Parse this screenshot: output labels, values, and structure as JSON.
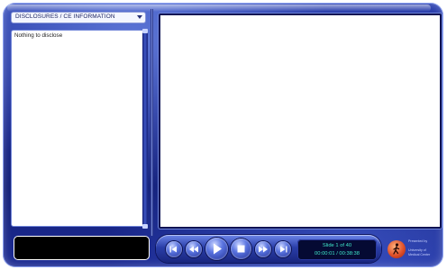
{
  "topic_select": {
    "value": "DISCLOSURES / CE INFORMATION"
  },
  "notes": {
    "text": "Nothing to disclose"
  },
  "player": {
    "slide_counter": "Slide 1 of 40",
    "time": "00:00:01 / 00:38:38",
    "controls": [
      {
        "name": "first-slide-button",
        "icon": "skip-to-start"
      },
      {
        "name": "rewind-button",
        "icon": "rewind"
      },
      {
        "name": "play-button",
        "icon": "play"
      },
      {
        "name": "stop-button",
        "icon": "stop"
      },
      {
        "name": "fast-forward-button",
        "icon": "fast-forward"
      },
      {
        "name": "last-slide-button",
        "icon": "skip-to-end"
      }
    ]
  },
  "presenter": {
    "logo_line1": "Presented by",
    "logo_line2": "University of",
    "logo_line3": "Medical Center"
  },
  "colors": {
    "frame": "#1a2890",
    "readout_text": "#3fe7c9",
    "accent_logo": "#e0502a"
  }
}
